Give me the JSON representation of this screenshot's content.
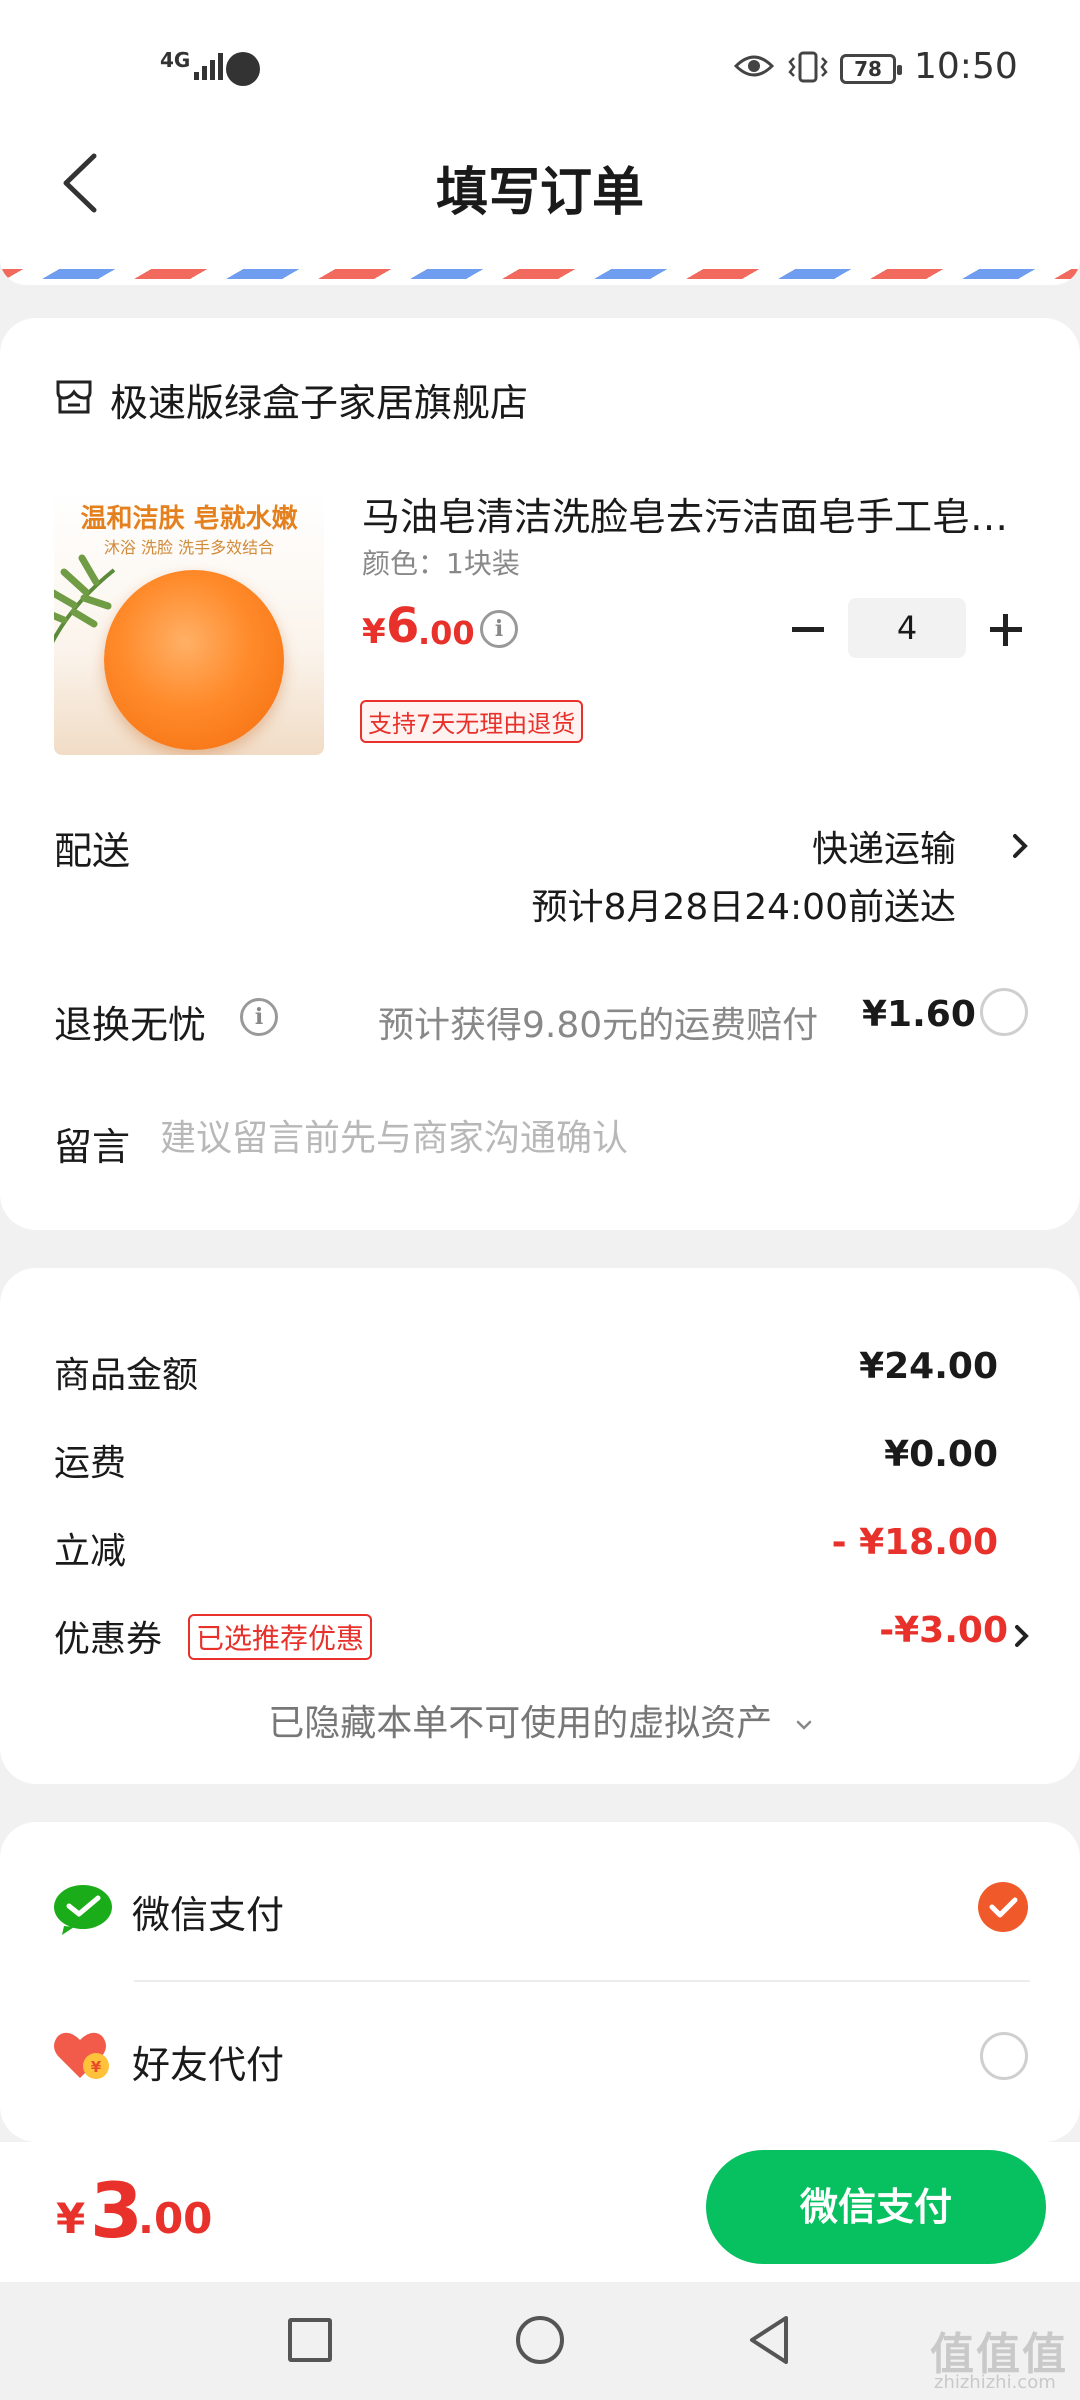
{
  "status_bar": {
    "signal": "4G",
    "battery": "78",
    "time": "10:50"
  },
  "header": {
    "title": "填写订单"
  },
  "store": {
    "name": "极速版绿盒子家居旗舰店"
  },
  "product": {
    "image_caption": "温和洁肤 皂就水嫩",
    "image_subcaption": "沐浴 洗脸 洗手多效结合",
    "title": "马油皂清洁洗脸皂去污洁面皂手工皂…",
    "spec": "颜色：1块装",
    "price_currency": "¥",
    "price_int": "6",
    "price_dec": ".00",
    "quantity": "4",
    "return_badge": "支持7天无理由退货"
  },
  "shipping": {
    "label": "配送",
    "method": "快递运输",
    "estimate": "预计8月28日24:00前送达"
  },
  "return_insurance": {
    "label": "退换无忧",
    "text": "预计获得9.80元的运费赔付",
    "price": "¥1.60",
    "selected": false
  },
  "message": {
    "label": "留言",
    "placeholder": "建议留言前先与商家沟通确认",
    "value": ""
  },
  "summary": {
    "goods_label": "商品金额",
    "goods_value": "¥24.00",
    "shipping_label": "运费",
    "shipping_value": "¥0.00",
    "discount_label": "立减",
    "discount_value": "- ¥18.00",
    "coupon_label": "优惠券",
    "coupon_badge": "已选推荐优惠",
    "coupon_value": "-¥3.00",
    "hidden_assets": "已隐藏本单不可使用的虚拟资产"
  },
  "payment": {
    "options": [
      {
        "label": "微信支付",
        "icon": "wechat-pay-icon",
        "selected": true
      },
      {
        "label": "好友代付",
        "icon": "friend-pay-icon",
        "selected": false
      }
    ]
  },
  "bottom_bar": {
    "total_currency": "¥",
    "total_int": "3",
    "total_dec": ".00",
    "pay_button": "微信支付"
  },
  "watermark": {
    "text": "值值值",
    "sub": "zhizhizhi.com"
  },
  "colors": {
    "accent_red": "#e8312a",
    "wechat_green": "#07c160",
    "check_orange": "#f05a2a"
  }
}
